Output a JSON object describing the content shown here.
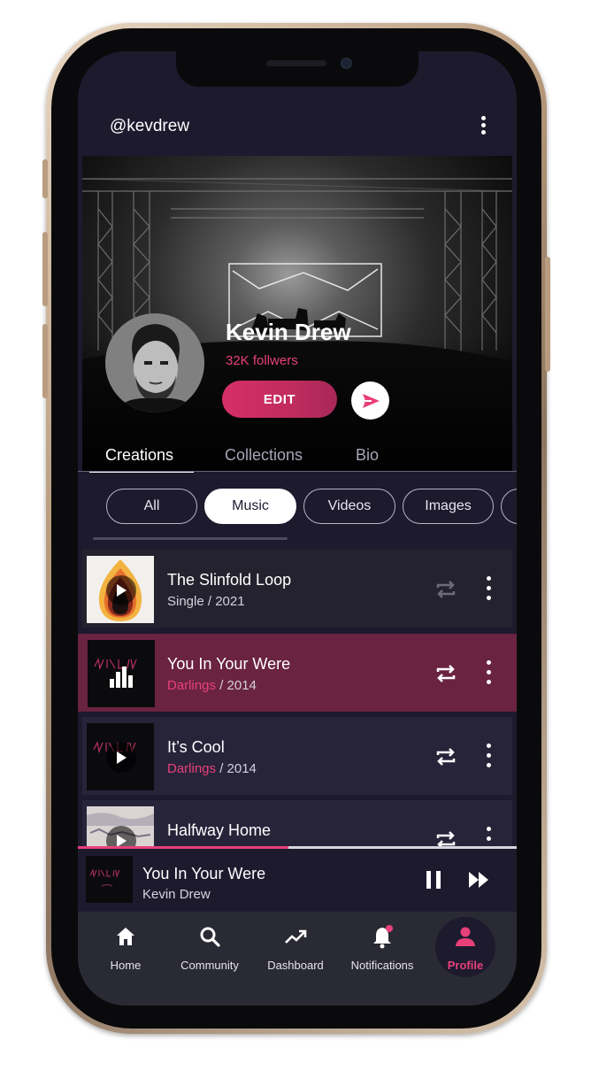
{
  "header": {
    "username": "@kevdrew"
  },
  "profile": {
    "name": "Kevin Drew",
    "followers": "32K follwers",
    "edit_label": "EDIT"
  },
  "tabs": [
    {
      "label": "Creations",
      "active": true
    },
    {
      "label": "Collections",
      "active": false
    },
    {
      "label": "Bio",
      "active": false
    }
  ],
  "filters": [
    {
      "label": "All",
      "active": false
    },
    {
      "label": "Music",
      "active": true
    },
    {
      "label": "Videos",
      "active": false
    },
    {
      "label": "Images",
      "active": false
    }
  ],
  "tracks": [
    {
      "title": "The Slinfold Loop",
      "album": "",
      "meta": "Single / 2021",
      "state": "idle",
      "repeat": "dimmed"
    },
    {
      "title": "You In Your Were",
      "album": "Darlings",
      "meta": " / 2014",
      "state": "playing",
      "repeat": "active"
    },
    {
      "title": "It’s Cool",
      "album": "Darlings",
      "meta": " / 2014",
      "state": "idle",
      "repeat": "active"
    },
    {
      "title": "Halfway Home",
      "album": "",
      "meta": "",
      "state": "idle",
      "repeat": "active"
    }
  ],
  "now_playing": {
    "title": "You In Your Were",
    "artist": "Kevin Drew",
    "progress": 0.48
  },
  "nav": [
    {
      "label": "Home",
      "icon": "home-icon",
      "active": false
    },
    {
      "label": "Community",
      "icon": "search-icon",
      "active": false
    },
    {
      "label": "Dashboard",
      "icon": "trending-up-icon",
      "active": false
    },
    {
      "label": "Notifications",
      "icon": "bell-icon",
      "active": false,
      "badge": true
    },
    {
      "label": "Profile",
      "icon": "person-icon",
      "active": true
    }
  ],
  "colors": {
    "accent": "#e8407a",
    "background": "#1d1a2e",
    "playing_row": "#6a2340",
    "nav_bar": "#2a2a34"
  }
}
